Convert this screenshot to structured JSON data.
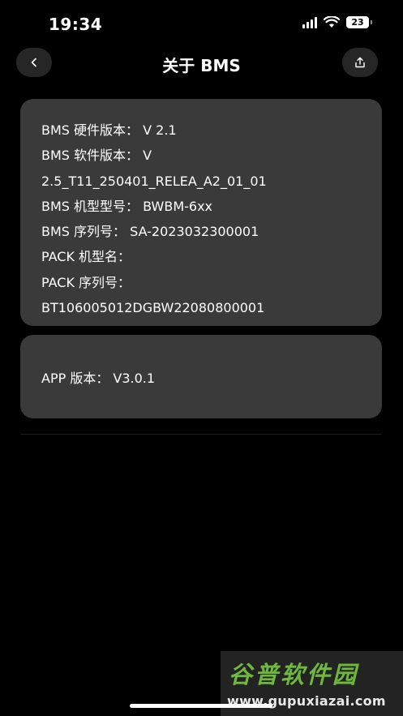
{
  "status_bar": {
    "time": "19:34",
    "battery": "23"
  },
  "nav": {
    "title": "关于 BMS",
    "back_icon": "chevron-left-icon",
    "share_icon": "share-icon"
  },
  "bms_info": {
    "lines": [
      "BMS 硬件版本：  V 2.1",
      "BMS 软件版本：  V",
      "2.5_T11_250401_RELEA_A2_01_01",
      "BMS 机型型号：  BWBM-6xx",
      "BMS 序列号：  SA-2023032300001",
      "PACK 机型名：",
      "PACK 序列号：",
      "BT106005012DGBW22080800001"
    ]
  },
  "app_info": {
    "line": "APP 版本：  V3.0.1"
  },
  "watermark": {
    "logo_text": "谷普软件园",
    "url": "www.gupuxiazai.com"
  },
  "colors": {
    "background": "#000000",
    "card": "#3a3a3a",
    "nav_button": "#262626",
    "text": "#ffffff",
    "watermark_green": "#6fb83e"
  }
}
